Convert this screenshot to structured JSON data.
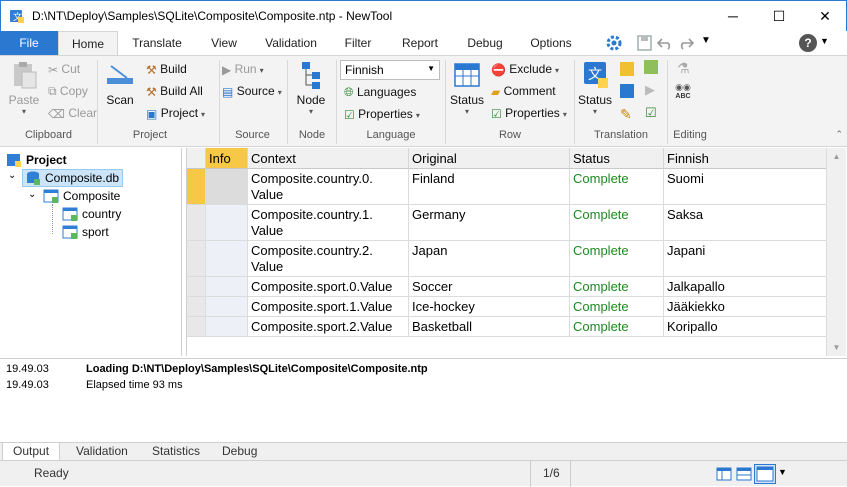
{
  "window": {
    "title": "D:\\NT\\Deploy\\Samples\\SQLite\\Composite\\Composite.ntp - NewTool",
    "minimize": "─",
    "maximize": "☐",
    "close": "✕"
  },
  "ribbon_tabs": [
    "File",
    "Home",
    "Translate",
    "View",
    "Validation",
    "Filter",
    "Report",
    "Debug",
    "Options"
  ],
  "quick_access": {
    "help": "?"
  },
  "ribbon": {
    "clipboard": {
      "paste": "Paste",
      "cut": "Cut",
      "copy": "Copy",
      "clear": "Clear",
      "label": "Clipboard"
    },
    "project": {
      "scan": "Scan",
      "build": "Build",
      "build_all": "Build All",
      "project": "Project",
      "label": "Project"
    },
    "source": {
      "run": "Run",
      "source": "Source",
      "label": "Source"
    },
    "node": {
      "node": "Node",
      "label": "Node"
    },
    "language": {
      "selected": "Finnish",
      "languages": "Languages",
      "properties": "Properties",
      "label": "Language"
    },
    "row": {
      "status": "Status",
      "exclude": "Exclude",
      "comment": "Comment",
      "properties": "Properties",
      "label": "Row"
    },
    "translation": {
      "status": "Status",
      "label": "Translation"
    },
    "editing": {
      "label": "Editing",
      "abc": "ABC"
    }
  },
  "tree": {
    "root": "Project",
    "db": "Composite.db",
    "table": "Composite",
    "children": [
      "country",
      "sport"
    ]
  },
  "grid": {
    "columns": [
      "Info",
      "Context",
      "Original",
      "Status",
      "Finnish"
    ],
    "rows": [
      {
        "context": "Composite.country.0.\nValue",
        "original": "Finland",
        "status": "Complete",
        "finnish": "Suomi"
      },
      {
        "context": "Composite.country.1.\nValue",
        "original": "Germany",
        "status": "Complete",
        "finnish": "Saksa"
      },
      {
        "context": "Composite.country.2.\nValue",
        "original": "Japan",
        "status": "Complete",
        "finnish": "Japani"
      },
      {
        "context": "Composite.sport.0.Value",
        "original": "Soccer",
        "status": "Complete",
        "finnish": "Jalkapallo"
      },
      {
        "context": "Composite.sport.1.Value",
        "original": "Ice-hockey",
        "status": "Complete",
        "finnish": "Jääkiekko"
      },
      {
        "context": "Composite.sport.2.Value",
        "original": "Basketball",
        "status": "Complete",
        "finnish": "Koripallo"
      }
    ]
  },
  "log": [
    {
      "time": "19.49.03",
      "message": "Loading D:\\NT\\Deploy\\Samples\\SQLite\\Composite\\Composite.ntp",
      "bold": true
    },
    {
      "time": "19.49.03",
      "message": "Elapsed time 93 ms",
      "bold": false
    }
  ],
  "bottom_tabs": [
    "Output",
    "Validation",
    "Statistics",
    "Debug"
  ],
  "status_bar": {
    "state": "Ready",
    "position": "1/6"
  },
  "colors": {
    "accent": "#2b78d1",
    "complete": "#1e8a1e",
    "info_header": "#f7c845"
  }
}
